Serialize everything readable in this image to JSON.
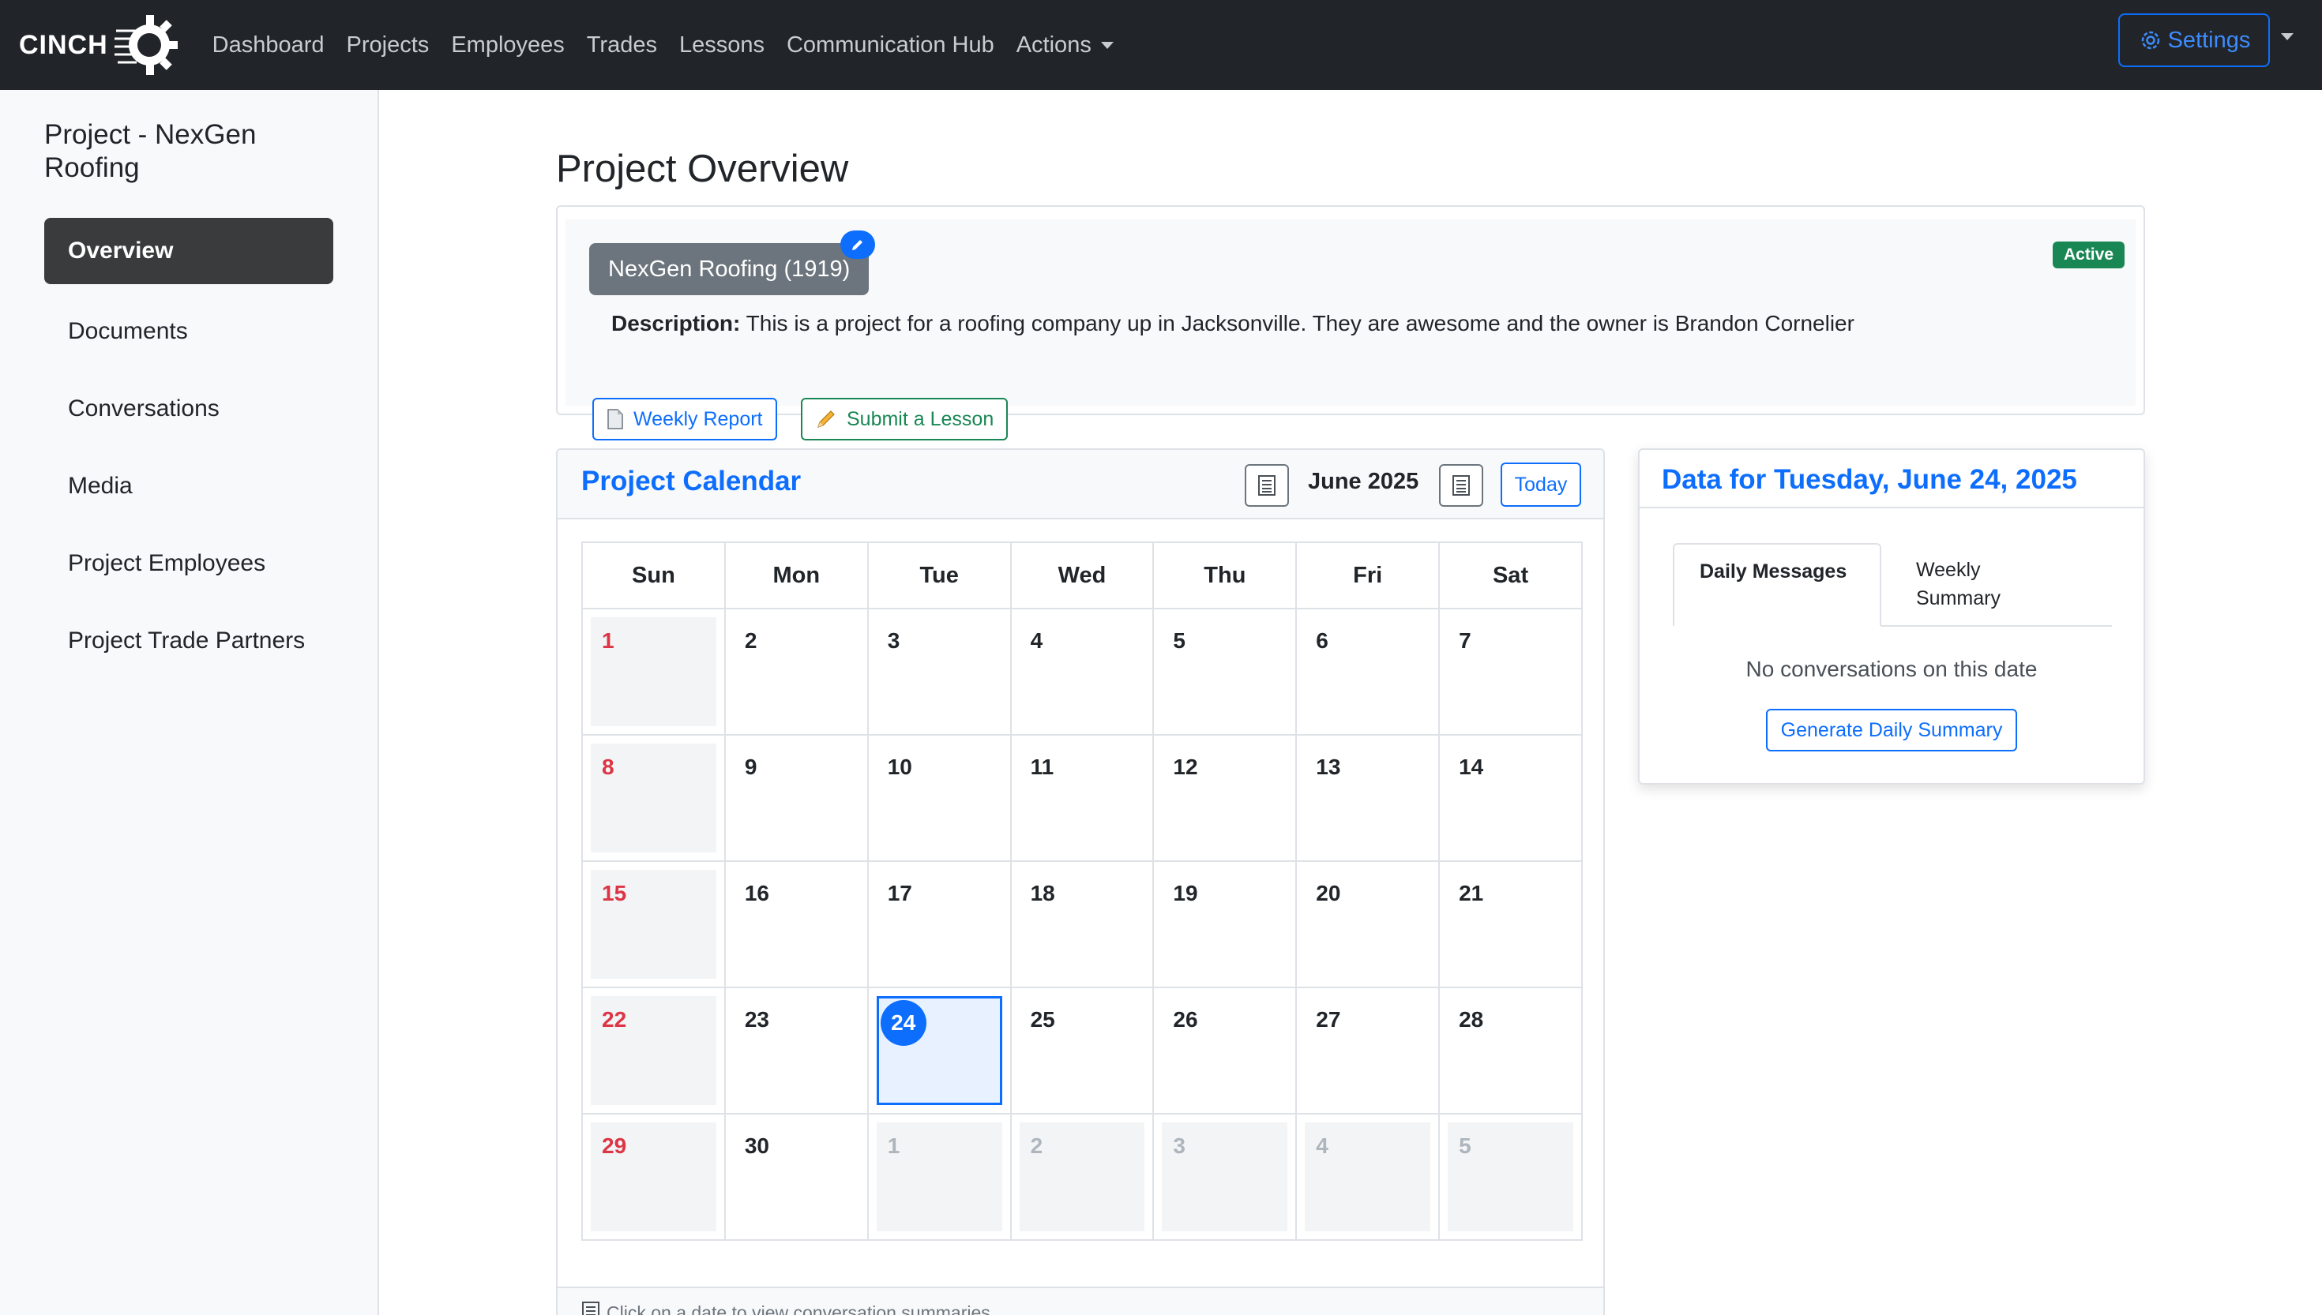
{
  "navbar": {
    "brand": "CINCH",
    "links": [
      "Dashboard",
      "Projects",
      "Employees",
      "Trades",
      "Lessons",
      "Communication Hub",
      "Actions"
    ],
    "settings_label": "Settings",
    "background": "#212529",
    "accent": "#0d6efd"
  },
  "sidebar": {
    "title": "Project - NexGen Roofing",
    "items": [
      {
        "label": "Overview",
        "active": true
      },
      {
        "label": "Documents"
      },
      {
        "label": "Conversations"
      },
      {
        "label": "Media"
      },
      {
        "label": "Project Employees"
      },
      {
        "label": "Project Trade Partners"
      }
    ]
  },
  "overview": {
    "page_title": "Project Overview",
    "project_name": "NexGen Roofing (1919)",
    "status": "Active",
    "description_label": "Description:",
    "description": "This is a project for a roofing company up in Jacksonville. They are awesome and the owner is Brandon Cornelier",
    "weekly_report_label": "Weekly Report",
    "submit_lesson_label": "Submit a Lesson"
  },
  "calendar": {
    "title": "Project Calendar",
    "month_label": "June 2025",
    "today_label": "Today",
    "weekdays": [
      "Sun",
      "Mon",
      "Tue",
      "Wed",
      "Thu",
      "Fri",
      "Sat"
    ],
    "weeks": [
      [
        "1",
        "2",
        "3",
        "4",
        "5",
        "6",
        "7"
      ],
      [
        "8",
        "9",
        "10",
        "11",
        "12",
        "13",
        "14"
      ],
      [
        "15",
        "16",
        "17",
        "18",
        "19",
        "20",
        "21"
      ],
      [
        "22",
        "23",
        "24",
        "25",
        "26",
        "27",
        "28"
      ],
      [
        "29",
        "30",
        "1",
        "2",
        "3",
        "4",
        "5"
      ]
    ],
    "selected_day": "24",
    "footer_hint": "Click on a date to view conversation summaries"
  },
  "data_panel": {
    "title": "Data for Tuesday, June 24, 2025",
    "tabs": [
      "Daily Messages",
      "Weekly Summary"
    ],
    "empty_text": "No conversations on this date",
    "generate_label": "Generate Daily Summary"
  }
}
